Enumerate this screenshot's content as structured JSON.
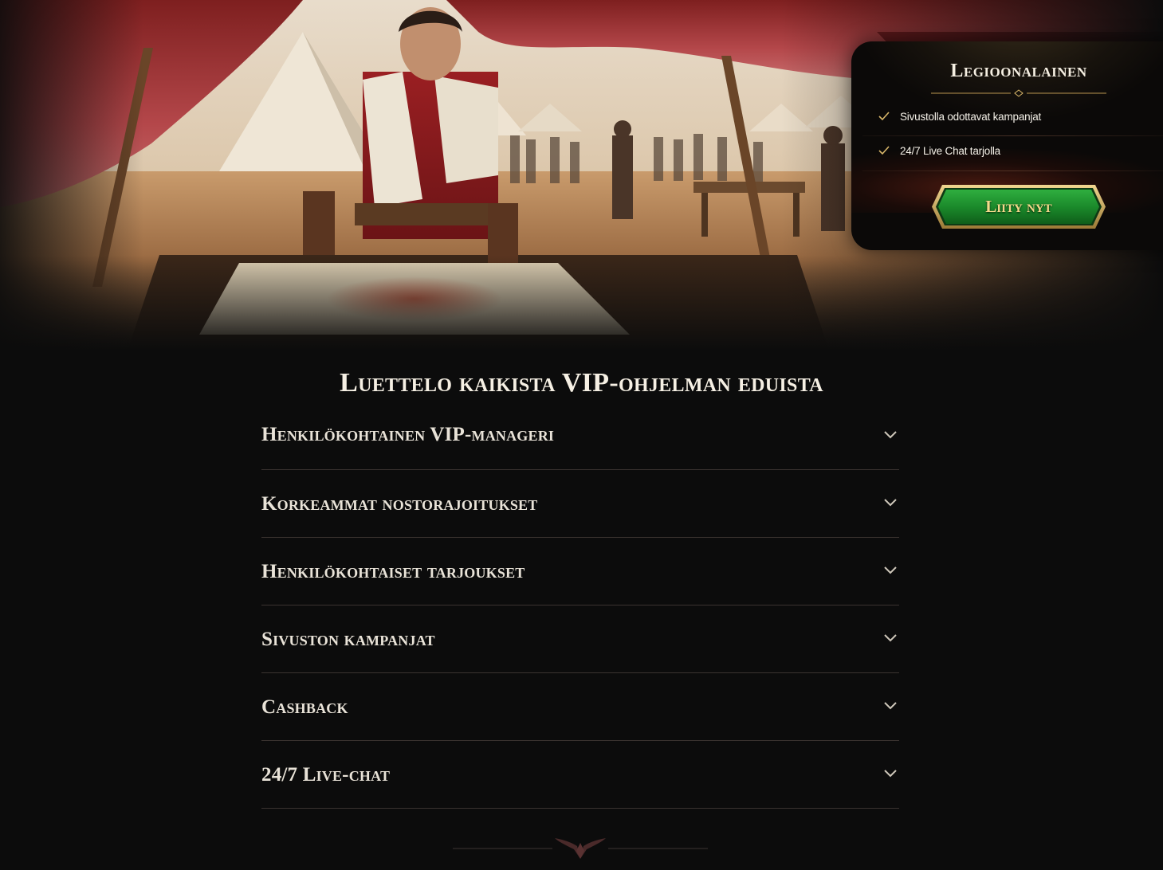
{
  "hero": {
    "image": "roman-general-studying-map-in-camp-tent"
  },
  "vip_card": {
    "title": "Legioonalainen",
    "benefits": [
      {
        "icon": "check-icon",
        "label": "Sivustolla odottavat kampanjat"
      },
      {
        "icon": "check-icon",
        "label": "24/7 Live Chat tarjolla"
      }
    ],
    "join_label": "Liity nyt"
  },
  "benefits_section": {
    "title": "Luettelo kaikista VIP-ohjelman eduista",
    "items": [
      {
        "label": "Henkilökohtainen VIP-manageri"
      },
      {
        "label": "Korkeammat nostorajoitukset"
      },
      {
        "label": "Henkilökohtaiset tarjoukset"
      },
      {
        "label": "Sivuston kampanjat"
      },
      {
        "label": "Cashback"
      },
      {
        "label": "24/7 Live-chat"
      }
    ]
  },
  "colors": {
    "background": "#0c0c0c",
    "gold": "#d9b76a",
    "button_green": "#1f8a2e",
    "text_light": "#f2ece0",
    "divider": "#3a3330"
  }
}
